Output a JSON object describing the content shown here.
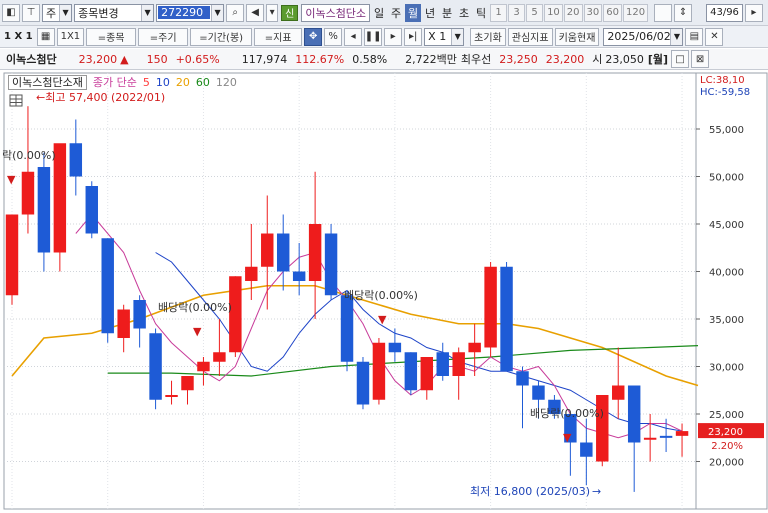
{
  "toolbar1": {
    "market": "주",
    "search_label": "종목변경",
    "code": "272290",
    "sin_badge": "신",
    "stock_name": "이녹스첨단소",
    "periods": [
      "일",
      "주",
      "월",
      "년",
      "분",
      "초",
      "틱"
    ],
    "selected_period": "월",
    "numbers": [
      "1",
      "3",
      "5",
      "10",
      "20",
      "30",
      "60",
      "120"
    ],
    "pager": "43/96"
  },
  "toolbar2": {
    "mult": "1 X 1",
    "grid_label": "1X1",
    "buttons": [
      "=종목",
      "=주기",
      "=기간(봉)",
      "=지표"
    ],
    "pct": "%",
    "zoom": "X 1",
    "reset": "초기화",
    "interest": "관심지표",
    "kiwoom": "키움현재",
    "date": "2025/06/02"
  },
  "infobar": {
    "name": "이녹스첨단",
    "price": "23,200",
    "arrow": "▲",
    "change": "150",
    "change_pct": "+0.65%",
    "volume": "117,974",
    "vol_ratio": "112.67%",
    "turnover": "0.58%",
    "amount": "2,722백만",
    "seller": "최우선",
    "bid1": "23,250",
    "bid2": "23,200",
    "open_label": "시",
    "open": "23,050",
    "period_tag": "[월]"
  },
  "legend": {
    "title": "이녹스첨단소재",
    "ma_label": "종가 단순",
    "ma_periods": [
      "5",
      "10",
      "20",
      "60",
      "120"
    ],
    "ma_colors": [
      "#ff3c3c",
      "#1e44c8",
      "#e8a000",
      "#1a8a1a",
      "#888888"
    ]
  },
  "stats": {
    "lc": "LC:38,10",
    "hc": "HC:-59,58"
  },
  "annotations": {
    "high": "←최고 57,400 (2022/01)",
    "low": "최저 16,800 (2025/03)",
    "dividend_labels": [
      "락(0.00%)",
      "배당락(0.00%)",
      "배당락(0.00%)",
      "배당락(0.00%)"
    ]
  },
  "current_price_label": "23,200",
  "current_pct_label": "2.20%",
  "chart_data": {
    "type": "candlestick",
    "y_ticks": [
      "55,000",
      "50,000",
      "45,000",
      "40,000",
      "35,000",
      "30,000",
      "25,000",
      "20,000"
    ],
    "ylim": [
      15000,
      59000
    ],
    "candles": [
      {
        "o": 37500,
        "h": 42000,
        "l": 36500,
        "c": 46000,
        "color": "up"
      },
      {
        "o": 46000,
        "h": 57400,
        "l": 44000,
        "c": 50500,
        "color": "up"
      },
      {
        "o": 51000,
        "h": 52500,
        "l": 40000,
        "c": 42000,
        "color": "down"
      },
      {
        "o": 42000,
        "h": 53000,
        "l": 40000,
        "c": 53500,
        "color": "up"
      },
      {
        "o": 53500,
        "h": 56000,
        "l": 48000,
        "c": 50000,
        "color": "down"
      },
      {
        "o": 49000,
        "h": 49500,
        "l": 43500,
        "c": 44000,
        "color": "down"
      },
      {
        "o": 43500,
        "h": 43500,
        "l": 32500,
        "c": 33500,
        "color": "down"
      },
      {
        "o": 33000,
        "h": 36500,
        "l": 31500,
        "c": 36000,
        "color": "up"
      },
      {
        "o": 37000,
        "h": 37500,
        "l": 32000,
        "c": 34000,
        "color": "down"
      },
      {
        "o": 33500,
        "h": 34000,
        "l": 25500,
        "c": 26500,
        "color": "down"
      },
      {
        "o": 27000,
        "h": 28500,
        "l": 26000,
        "c": 27000,
        "color": "up"
      },
      {
        "o": 27500,
        "h": 29000,
        "l": 26000,
        "c": 29000,
        "color": "up"
      },
      {
        "o": 29500,
        "h": 31000,
        "l": 28000,
        "c": 30500,
        "color": "up"
      },
      {
        "o": 30500,
        "h": 35000,
        "l": 29000,
        "c": 31500,
        "color": "up"
      },
      {
        "o": 31500,
        "h": 39500,
        "l": 31000,
        "c": 39500,
        "color": "up"
      },
      {
        "o": 39000,
        "h": 45000,
        "l": 37000,
        "c": 40500,
        "color": "up"
      },
      {
        "o": 40500,
        "h": 48000,
        "l": 36000,
        "c": 44000,
        "color": "up"
      },
      {
        "o": 44000,
        "h": 46000,
        "l": 38000,
        "c": 40000,
        "color": "down"
      },
      {
        "o": 40000,
        "h": 43000,
        "l": 37500,
        "c": 39000,
        "color": "down"
      },
      {
        "o": 39000,
        "h": 50500,
        "l": 35000,
        "c": 45000,
        "color": "up"
      },
      {
        "o": 44000,
        "h": 45000,
        "l": 37000,
        "c": 37500,
        "color": "down"
      },
      {
        "o": 37500,
        "h": 38000,
        "l": 29500,
        "c": 30500,
        "color": "down"
      },
      {
        "o": 30500,
        "h": 31000,
        "l": 25500,
        "c": 26000,
        "color": "down"
      },
      {
        "o": 26500,
        "h": 33000,
        "l": 26000,
        "c": 32500,
        "color": "up"
      },
      {
        "o": 32500,
        "h": 34000,
        "l": 30500,
        "c": 31500,
        "color": "down"
      },
      {
        "o": 31500,
        "h": 31500,
        "l": 27000,
        "c": 27500,
        "color": "down"
      },
      {
        "o": 27500,
        "h": 31000,
        "l": 26500,
        "c": 31000,
        "color": "up"
      },
      {
        "o": 31500,
        "h": 32500,
        "l": 28500,
        "c": 29000,
        "color": "down"
      },
      {
        "o": 29000,
        "h": 32000,
        "l": 26500,
        "c": 31500,
        "color": "up"
      },
      {
        "o": 31500,
        "h": 34500,
        "l": 29000,
        "c": 32500,
        "color": "up"
      },
      {
        "o": 32000,
        "h": 41000,
        "l": 31000,
        "c": 40500,
        "color": "up"
      },
      {
        "o": 40500,
        "h": 41000,
        "l": 29500,
        "c": 29500,
        "color": "down"
      },
      {
        "o": 29500,
        "h": 30000,
        "l": 23500,
        "c": 28000,
        "color": "down"
      },
      {
        "o": 28000,
        "h": 28500,
        "l": 24500,
        "c": 26500,
        "color": "down"
      },
      {
        "o": 26500,
        "h": 27000,
        "l": 24500,
        "c": 25000,
        "color": "down"
      },
      {
        "o": 25000,
        "h": 25000,
        "l": 18500,
        "c": 22000,
        "color": "down"
      },
      {
        "o": 22000,
        "h": 24500,
        "l": 17500,
        "c": 20500,
        "color": "down"
      },
      {
        "o": 20000,
        "h": 27000,
        "l": 19500,
        "c": 27000,
        "color": "up"
      },
      {
        "o": 26500,
        "h": 32000,
        "l": 24500,
        "c": 28000,
        "color": "up"
      },
      {
        "o": 28000,
        "h": 28000,
        "l": 16800,
        "c": 22000,
        "color": "down"
      },
      {
        "o": 22500,
        "h": 25000,
        "l": 20000,
        "c": 22500,
        "color": "up"
      },
      {
        "o": 22500,
        "h": 24500,
        "l": 21000,
        "c": 22700,
        "color": "down"
      },
      {
        "o": 22700,
        "h": 24000,
        "l": 20500,
        "c": 23200,
        "color": "up"
      }
    ],
    "ma5": [
      null,
      null,
      null,
      null,
      44000,
      46000,
      44000,
      42000,
      38000,
      34500,
      32500,
      31000,
      29500,
      28500,
      30000,
      34000,
      38000,
      40000,
      41500,
      42000,
      39000,
      37000,
      34500,
      31000,
      28500,
      27000,
      28000,
      30000,
      30000,
      29500,
      31000,
      30000,
      29500,
      30000,
      28000,
      25000,
      23500,
      23000,
      22500,
      23000,
      24000,
      24000,
      23200
    ],
    "ma10": [
      null,
      null,
      null,
      null,
      null,
      null,
      null,
      null,
      null,
      42000,
      41000,
      39000,
      37000,
      35000,
      32500,
      30000,
      29500,
      31000,
      33500,
      35500,
      37000,
      38000,
      36000,
      34500,
      33500,
      33000,
      32000,
      31500,
      30500,
      30000,
      29500,
      29500,
      29000,
      28500,
      28000,
      27500,
      26500,
      25500,
      24500,
      24000,
      24000,
      23500,
      23200
    ],
    "ma20": [
      null,
      null,
      null,
      null,
      null,
      null,
      null,
      null,
      null,
      null,
      null,
      null,
      null,
      null,
      null,
      null,
      null,
      null,
      null,
      35500,
      36000,
      36200,
      36000,
      36500,
      37000,
      36500,
      35500,
      34500,
      33500,
      33000,
      33000,
      33500,
      33500,
      33000,
      32500,
      32000,
      31000,
      30000,
      29500,
      29000,
      28500,
      28000,
      27800
    ],
    "ma60": [
      null,
      null,
      null,
      null,
      null,
      null,
      null,
      null,
      null,
      null,
      null,
      null,
      null,
      null,
      null,
      null,
      null,
      null,
      null,
      null,
      null,
      null,
      null,
      null,
      null,
      null,
      null,
      null,
      null,
      null,
      null,
      null,
      null,
      null,
      null,
      null,
      null,
      null,
      null,
      null,
      null,
      null,
      null
    ],
    "ma60_line": [
      [
        6,
        29300
      ],
      [
        10,
        29300
      ],
      [
        15,
        29000
      ],
      [
        20,
        30000
      ],
      [
        25,
        30500
      ],
      [
        30,
        31000
      ],
      [
        35,
        31700
      ],
      [
        40,
        32000
      ],
      [
        43,
        32200
      ]
    ],
    "ma20_line": [
      [
        0,
        29000
      ],
      [
        2,
        33000
      ],
      [
        5,
        33500
      ],
      [
        8,
        35000
      ],
      [
        12,
        37500
      ],
      [
        16,
        38500
      ],
      [
        19,
        38500
      ],
      [
        22,
        37000
      ],
      [
        25,
        35500
      ],
      [
        28,
        34500
      ],
      [
        31,
        34500
      ],
      [
        33,
        34000
      ],
      [
        35,
        33000
      ],
      [
        37,
        32000
      ],
      [
        39,
        30500
      ],
      [
        41,
        29000
      ],
      [
        43,
        28000
      ]
    ]
  }
}
